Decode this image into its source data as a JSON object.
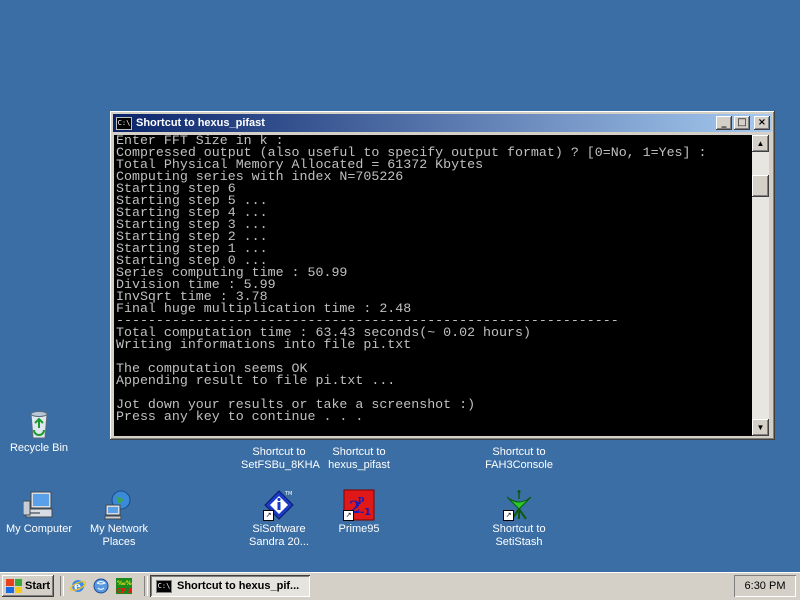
{
  "window": {
    "title": "Shortcut to hexus_pifast",
    "buttons": {
      "minimize": "_",
      "maximize": "□",
      "close": "×"
    },
    "console_lines": [
      "Enter FFT Size in k :",
      "Compressed output (also useful to specify output format) ? [0=No, 1=Yes] :",
      "Total Physical Memory Allocated = 61372 Kbytes",
      "Computing series with index N=705226",
      "Starting step 6",
      "Starting step 5 ...",
      "Starting step 4 ...",
      "Starting step 3 ...",
      "Starting step 2 ...",
      "Starting step 1 ...",
      "Starting step 0 ...",
      "Series computing time : 50.99",
      "Division time : 5.99",
      "InvSqrt time : 3.78",
      "Final huge multiplication time : 2.48",
      "---------------------------------------------------------------",
      "Total computation time : 63.43 seconds(~ 0.02 hours)",
      "Writing informations into file pi.txt",
      "",
      "The computation seems OK",
      "Appending result to file pi.txt ...",
      "",
      "Jot down your results or take a screenshot :)",
      "Press any key to continue . . ."
    ]
  },
  "desktop": {
    "icons": [
      {
        "label": "Recycle Bin",
        "icon": "recycle-bin-icon"
      },
      {
        "label": "Shortcut to SetFSBu_8KHA",
        "line1": "Shortcut to",
        "line2": "SetFSBu_8KHA"
      },
      {
        "label": "Shortcut to hexus_pifast",
        "line1": "Shortcut to",
        "line2": "hexus_pifast"
      },
      {
        "label": "Shortcut to FAH3Console",
        "line1": "Shortcut to",
        "line2": "FAH3Console"
      },
      {
        "label": "My Computer",
        "icon": "my-computer-icon"
      },
      {
        "label": "My Network Places",
        "line1": "My Network",
        "line2": "Places",
        "icon": "network-places-icon"
      },
      {
        "label": "SiSoftware Sandra 20...",
        "line1": "SiSoftware",
        "line2": "Sandra 20...",
        "icon": "sandra-icon"
      },
      {
        "label": "Prime95",
        "icon": "prime95-icon"
      },
      {
        "label": "Shortcut to SetiStash",
        "line1": "Shortcut to",
        "line2": "SetiStash",
        "icon": "seti-icon"
      }
    ]
  },
  "taskbar": {
    "start_label": "Start",
    "task_label": "Shortcut to hexus_pif...",
    "clock": "6:30 PM"
  },
  "colors": {
    "desktop": "#3a6ea5",
    "titlebar_start": "#0a246a",
    "titlebar_end": "#a6caf0",
    "console_bg": "#000000",
    "console_text": "#c0c0c0"
  }
}
